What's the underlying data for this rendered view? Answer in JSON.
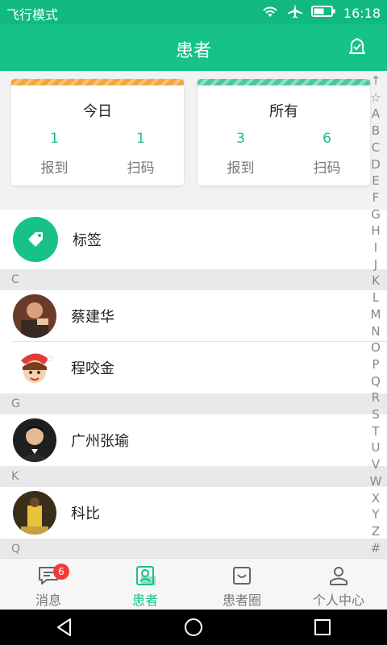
{
  "status": {
    "mode": "飞行模式",
    "time": "16:18"
  },
  "header": {
    "title": "患者",
    "action_icon": "bell-check-icon"
  },
  "cards": [
    {
      "title": "今日",
      "checkin_value": "1",
      "scan_value": "1",
      "checkin_label": "报到",
      "scan_label": "扫码"
    },
    {
      "title": "所有",
      "checkin_value": "3",
      "scan_value": "6",
      "checkin_label": "报到",
      "scan_label": "扫码"
    }
  ],
  "list": {
    "tag_label": "标签",
    "sections": [
      {
        "letter": "C",
        "items": [
          "蔡建华",
          "程咬金"
        ]
      },
      {
        "letter": "G",
        "items": [
          "广州张瑜"
        ]
      },
      {
        "letter": "K",
        "items": [
          "科比"
        ]
      },
      {
        "letter": "Q",
        "items": []
      }
    ]
  },
  "index_letters": [
    "↑",
    "☆",
    "A",
    "B",
    "C",
    "D",
    "E",
    "F",
    "G",
    "H",
    "I",
    "J",
    "K",
    "L",
    "M",
    "N",
    "O",
    "P",
    "Q",
    "R",
    "S",
    "T",
    "U",
    "V",
    "W",
    "X",
    "Y",
    "Z",
    "#"
  ],
  "tabs": [
    {
      "label": "消息",
      "icon": "message-icon",
      "badge": "6"
    },
    {
      "label": "患者",
      "icon": "patients-icon",
      "active": true
    },
    {
      "label": "患者圈",
      "icon": "patient-circle-icon"
    },
    {
      "label": "个人中心",
      "icon": "profile-icon"
    }
  ],
  "colors": {
    "primary": "#16c28a",
    "badge": "#f23a3a",
    "orange_stripe": "#f6a53c"
  }
}
